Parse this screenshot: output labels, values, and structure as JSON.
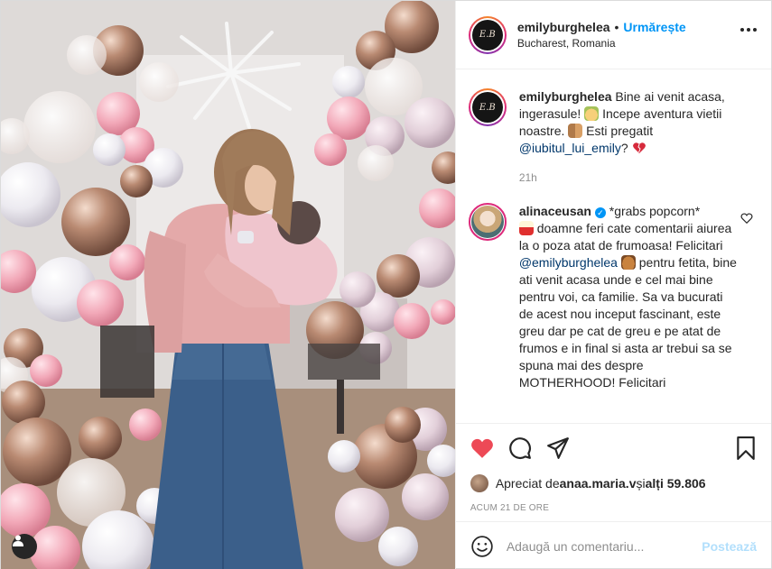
{
  "post": {
    "author": "emilyburghelea",
    "avatar_monogram": "E.B",
    "follow_label": "Urmărește",
    "separator": "•",
    "location": "Bucharest, Romania"
  },
  "caption": {
    "username": "emilyburghelea",
    "text_part1": " Bine ai venit acasa, ingerasule! ",
    "text_part2": " Incepe aventura vietii noastre. ",
    "text_part3": " Esti pregatit ",
    "mention": "@iubitul_lui_emily",
    "text_part4": "? ",
    "time": "21h",
    "emojis": [
      "baby-angel-emoji",
      "couple-emoji",
      "broken-heart-emoji"
    ]
  },
  "comment": {
    "username": "alinaceusan",
    "verified": true,
    "text_part1": " *grabs popcorn* ",
    "text_part2": " doamne feri cate comentarii aiurea la o poza atat de frumoasa! Felicitari ",
    "mention": "@emilyburghelea",
    "text_part3": " pentru fetita, bine ati venit acasa unde e cel mai bine pentru voi, ca familie. Sa va bucurati de acest nou inceput fascinant, este greu dar pe cat de greu e pe atat de frumos e in final si asta ar trebui sa se spuna mai des despre MOTHERHOOD! Felicitari"
  },
  "likes": {
    "prefix": "Apreciat de ",
    "first_user": "anaa.maria.v",
    "joiner": " și ",
    "others": "alți 59.806"
  },
  "timestamp": "ACUM 21 DE ORE",
  "add_comment": {
    "placeholder": "Adaugă un comentariu...",
    "post_label": "Postează"
  },
  "colors": {
    "accent": "#0095f6",
    "like_red": "#ed4956",
    "mention": "#00376b",
    "muted": "#8e8e8e"
  },
  "icons": [
    "heart-icon",
    "comment-icon",
    "share-icon",
    "bookmark-icon",
    "emoji-icon",
    "user-tag-icon",
    "more-options-icon"
  ]
}
